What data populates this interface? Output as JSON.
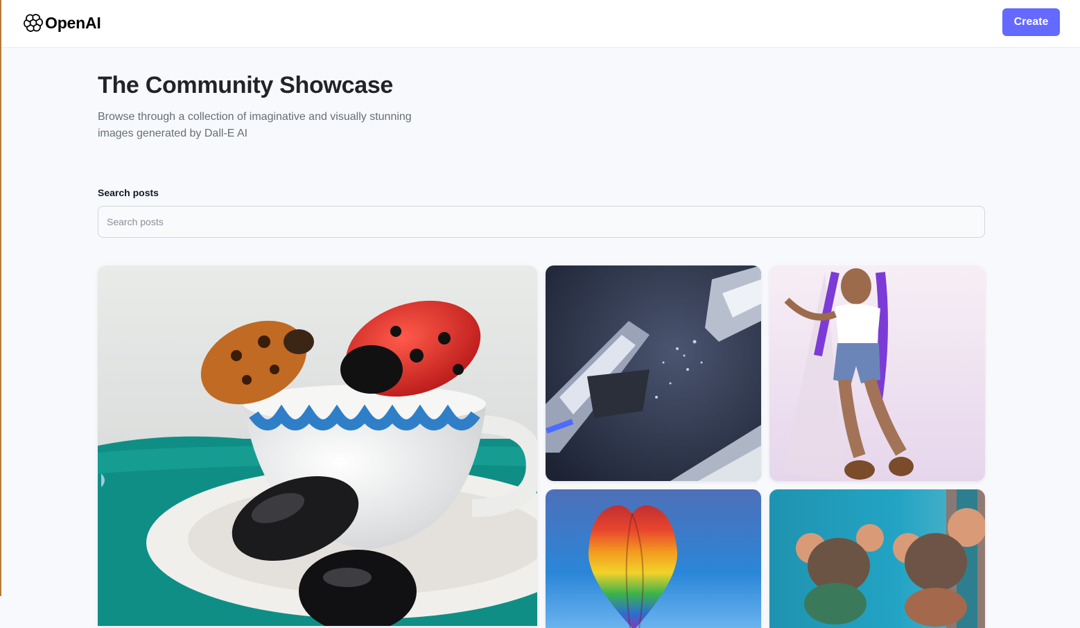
{
  "header": {
    "brand": "OpenAI",
    "create_label": "Create",
    "accent_color": "#6469ff"
  },
  "hero": {
    "title": "The Community Showcase",
    "subtitle": "Browse through a collection of imaginative and visually stunning images generated by Dall-E AI"
  },
  "search": {
    "label": "Search posts",
    "placeholder": "Search posts",
    "value": ""
  },
  "posts": [
    {
      "image": "ladybugs on a teacup"
    },
    {
      "image": "shattered spaceship in space"
    },
    {
      "image": "woman with purple braids"
    },
    {
      "image": "rainbow hot air balloon"
    },
    {
      "image": "two mice characters"
    }
  ]
}
